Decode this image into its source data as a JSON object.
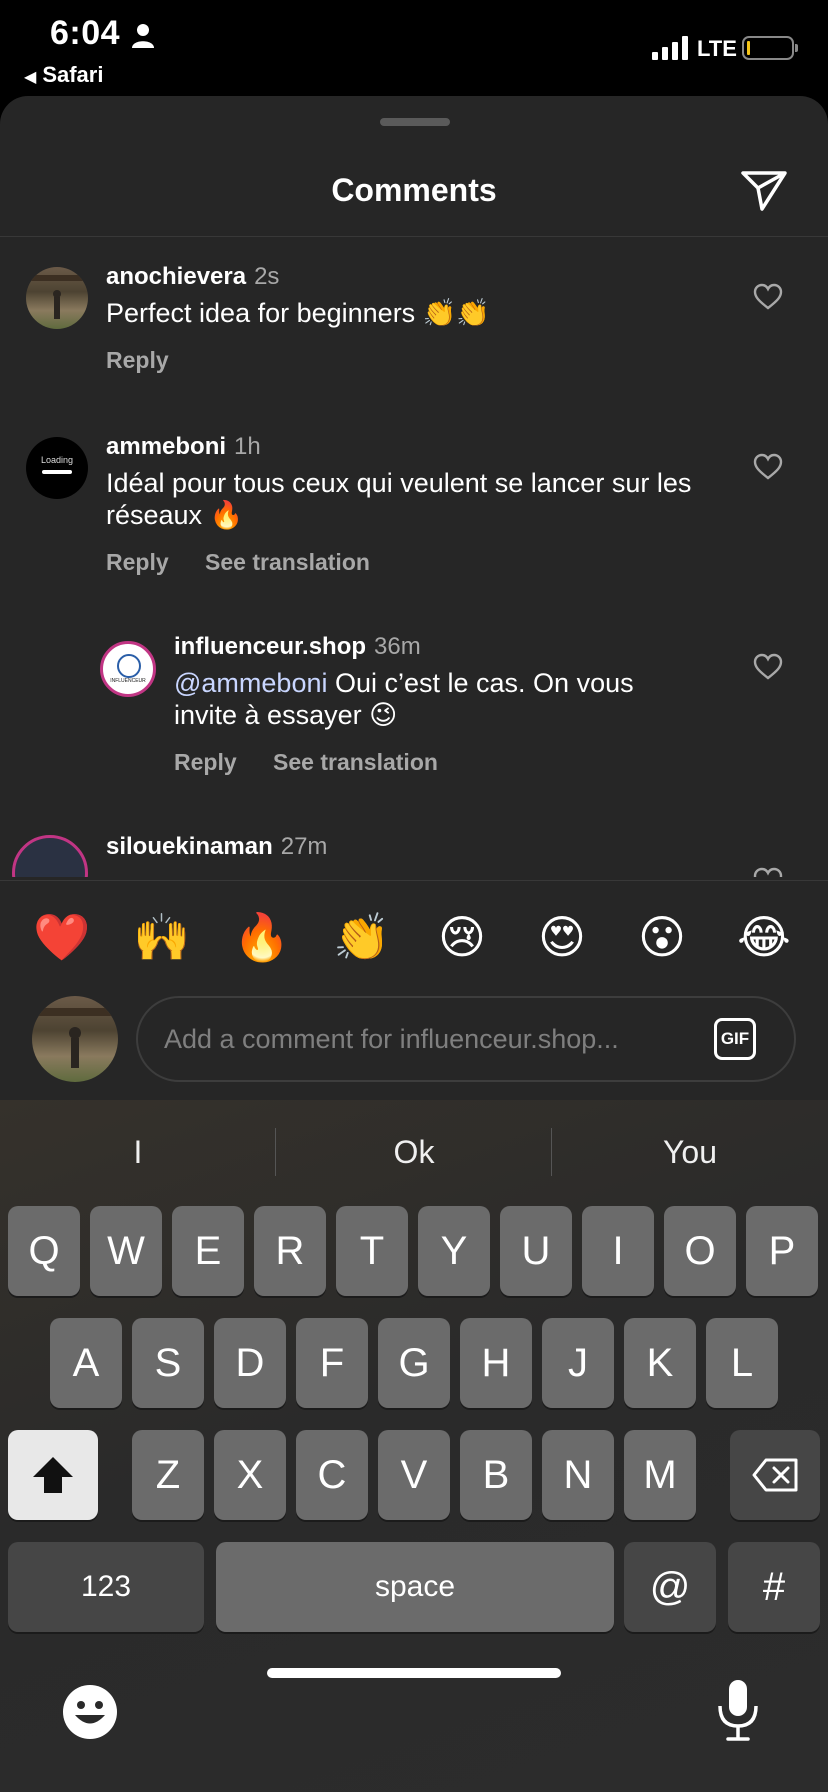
{
  "status_bar": {
    "time": "6:04",
    "back_app": "Safari",
    "network": "LTE"
  },
  "sheet": {
    "title": "Comments"
  },
  "comments": [
    {
      "username": "anochievera",
      "time": "2s",
      "text": "Perfect idea for beginners 👏👏",
      "reply_label": "Reply"
    },
    {
      "username": "ammeboni",
      "time": "1h",
      "avatar_text": "Loading",
      "text": "Idéal pour tous ceux qui veulent se lancer sur les réseaux 🔥",
      "reply_label": "Reply",
      "translation_label": "See translation"
    },
    {
      "username": "influenceur.shop",
      "time": "36m",
      "avatar_text": "INFLUENCEUR",
      "mention": "@ammeboni",
      "text": " Oui c’est le cas. On vous invite à essayer 😉",
      "reply_label": "Reply",
      "translation_label": "See translation"
    },
    {
      "username": "silouekinaman",
      "time": "27m"
    }
  ],
  "emoji_bar": [
    "❤️",
    "🙌",
    "🔥",
    "👏",
    "😢",
    "😍",
    "😮",
    "😂"
  ],
  "composer": {
    "placeholder": "Add a comment for influenceur.shop...",
    "gif_label": "GIF"
  },
  "keyboard": {
    "suggestions": [
      "I",
      "Ok",
      "You"
    ],
    "row1": [
      "Q",
      "W",
      "E",
      "R",
      "T",
      "Y",
      "U",
      "I",
      "O",
      "P"
    ],
    "row2": [
      "A",
      "S",
      "D",
      "F",
      "G",
      "H",
      "J",
      "K",
      "L"
    ],
    "row3": [
      "Z",
      "X",
      "C",
      "V",
      "B",
      "N",
      "M"
    ],
    "numbers_label": "123",
    "space_label": "space",
    "at_label": "@",
    "hash_label": "#"
  }
}
